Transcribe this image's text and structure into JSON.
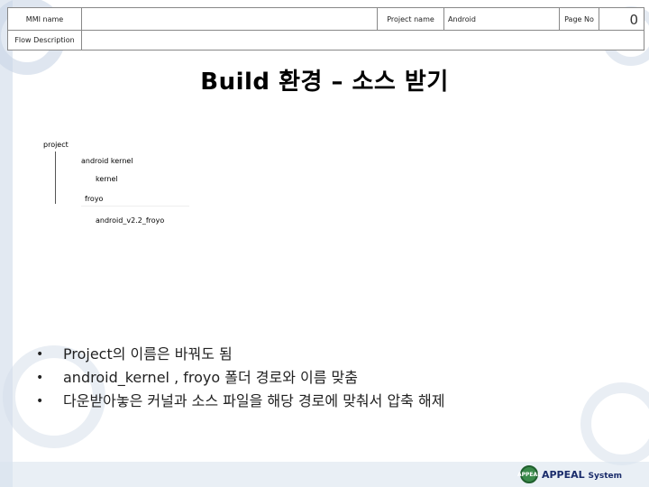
{
  "header": {
    "mmi_label": "MMI name",
    "mmi_value": "",
    "project_label": "Project name",
    "project_value": "Android",
    "page_label": "Page No",
    "page_value": "",
    "page_number": "0",
    "flow_label": "Flow Description",
    "flow_value": ""
  },
  "title": "Build 환경 – 소스 받기",
  "tree": {
    "root": "project",
    "child1": "android kernel",
    "child1_sub": "kernel",
    "child2": "froyo",
    "child2_sub": "android_v2.2_froyo"
  },
  "bullets": [
    "Project의 이름은 바꿔도 됨",
    "android_kernel , froyo 폴더 경로와 이름 맞춤",
    "다운받아놓은 커널과 소스 파일을 해당 경로에 맞춰서 압축 해제"
  ],
  "footer": {
    "logo_mark": "APPEAL",
    "logo_name": "APPEAL",
    "logo_sub": "System"
  },
  "colors": {
    "decor": "#c9d6e6",
    "logo_green": "#3a8a4a",
    "logo_navy": "#1a2c6b"
  }
}
